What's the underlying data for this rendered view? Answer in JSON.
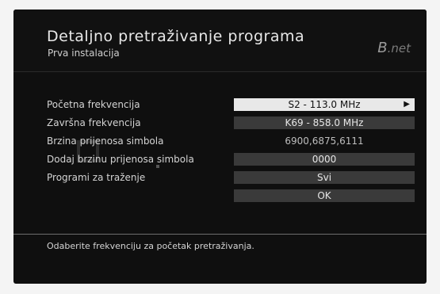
{
  "header": {
    "title": "Detaljno pretraživanje programa",
    "subtitle": "Prva instalacija",
    "logo_main": "B",
    "logo_suffix": ".net"
  },
  "rows": [
    {
      "label": "Početna frekvencija",
      "value": "S2 - 113.0 MHz"
    },
    {
      "label": "Završna frekvencija",
      "value": "K69 - 858.0 MHz"
    },
    {
      "label": "Brzina prijenosa simbola",
      "value": "6900,6875,6111"
    },
    {
      "label": "Dodaj brzinu prijenosa simbola",
      "value": "0000"
    },
    {
      "label": "Programi za traženje",
      "value": "Svi"
    }
  ],
  "ok_label": "OK",
  "footer": "Odaberite frekvenciju za početak pretraživanja.",
  "icons": {
    "arrow": "arrow-right-icon"
  }
}
